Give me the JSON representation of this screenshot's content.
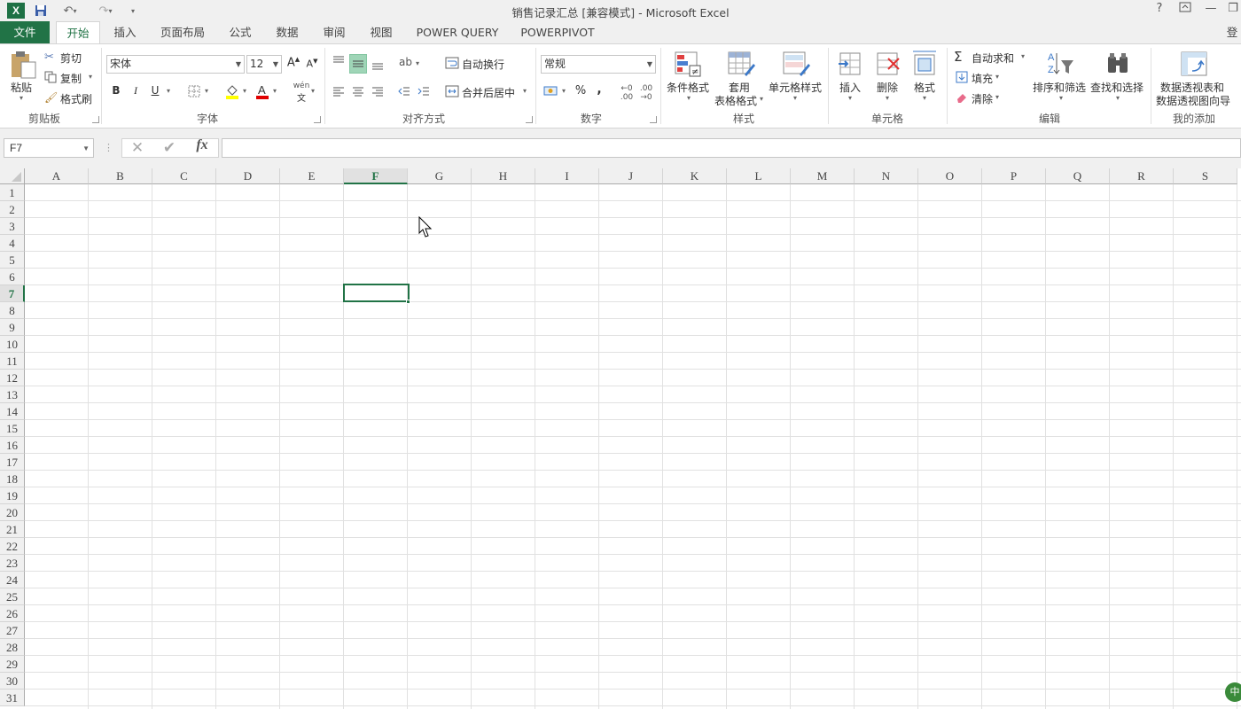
{
  "window": {
    "title": "销售记录汇总  [兼容模式] - Microsoft Excel",
    "help": "?",
    "minimize": "—",
    "restore": "❐"
  },
  "tabs": {
    "file": "文件",
    "home": "开始",
    "insert": "插入",
    "page_layout": "页面布局",
    "formulas": "公式",
    "data": "数据",
    "review": "审阅",
    "view": "视图",
    "power_query": "POWER QUERY",
    "powerpivot": "POWERPIVOT",
    "sign_in": "登"
  },
  "clipboard": {
    "paste": "粘贴",
    "cut": "剪切",
    "copy": "复制",
    "format_painter": "格式刷",
    "label": "剪贴板"
  },
  "font": {
    "name": "宋体",
    "size": "12",
    "bold": "B",
    "italic": "I",
    "underline": "U",
    "phonetic": "wén",
    "label": "字体"
  },
  "alignment": {
    "wrap_text": "自动换行",
    "merge_center": "合并后居中",
    "label": "对齐方式"
  },
  "number": {
    "format": "常规",
    "percent": "%",
    "comma": ",",
    "label": "数字"
  },
  "styles": {
    "conditional": "条件格式",
    "table_format_1": "套用",
    "table_format_2": "表格格式",
    "cell_styles": "单元格样式",
    "label": "样式"
  },
  "cells": {
    "insert": "插入",
    "delete": "删除",
    "format": "格式",
    "label": "单元格"
  },
  "editing": {
    "autosum": "自动求和",
    "fill": "填充",
    "clear": "清除",
    "sort_filter": "排序和筛选",
    "find_select": "查找和选择",
    "label": "编辑"
  },
  "addins": {
    "pivot_1": "数据透视表和",
    "pivot_2": "数据透视图向导",
    "label": "我的添加"
  },
  "formula_bar": {
    "name_box": "F7",
    "fx": "fx",
    "value": ""
  },
  "sheet": {
    "columns": [
      "A",
      "B",
      "C",
      "D",
      "E",
      "F",
      "G",
      "H",
      "I",
      "J",
      "K",
      "L",
      "M",
      "N",
      "O",
      "P",
      "Q",
      "R",
      "S"
    ],
    "rows": [
      "1",
      "2",
      "3",
      "4",
      "5",
      "6",
      "7",
      "8",
      "9",
      "10",
      "11",
      "12",
      "13",
      "14",
      "15",
      "16",
      "17",
      "18",
      "19",
      "20",
      "21",
      "22",
      "23",
      "24",
      "25",
      "26",
      "27",
      "28",
      "29",
      "30",
      "31"
    ],
    "active_cell": "F7"
  },
  "ime": "中",
  "colors": {
    "accent": "#217346",
    "file_tab": "#217346"
  }
}
